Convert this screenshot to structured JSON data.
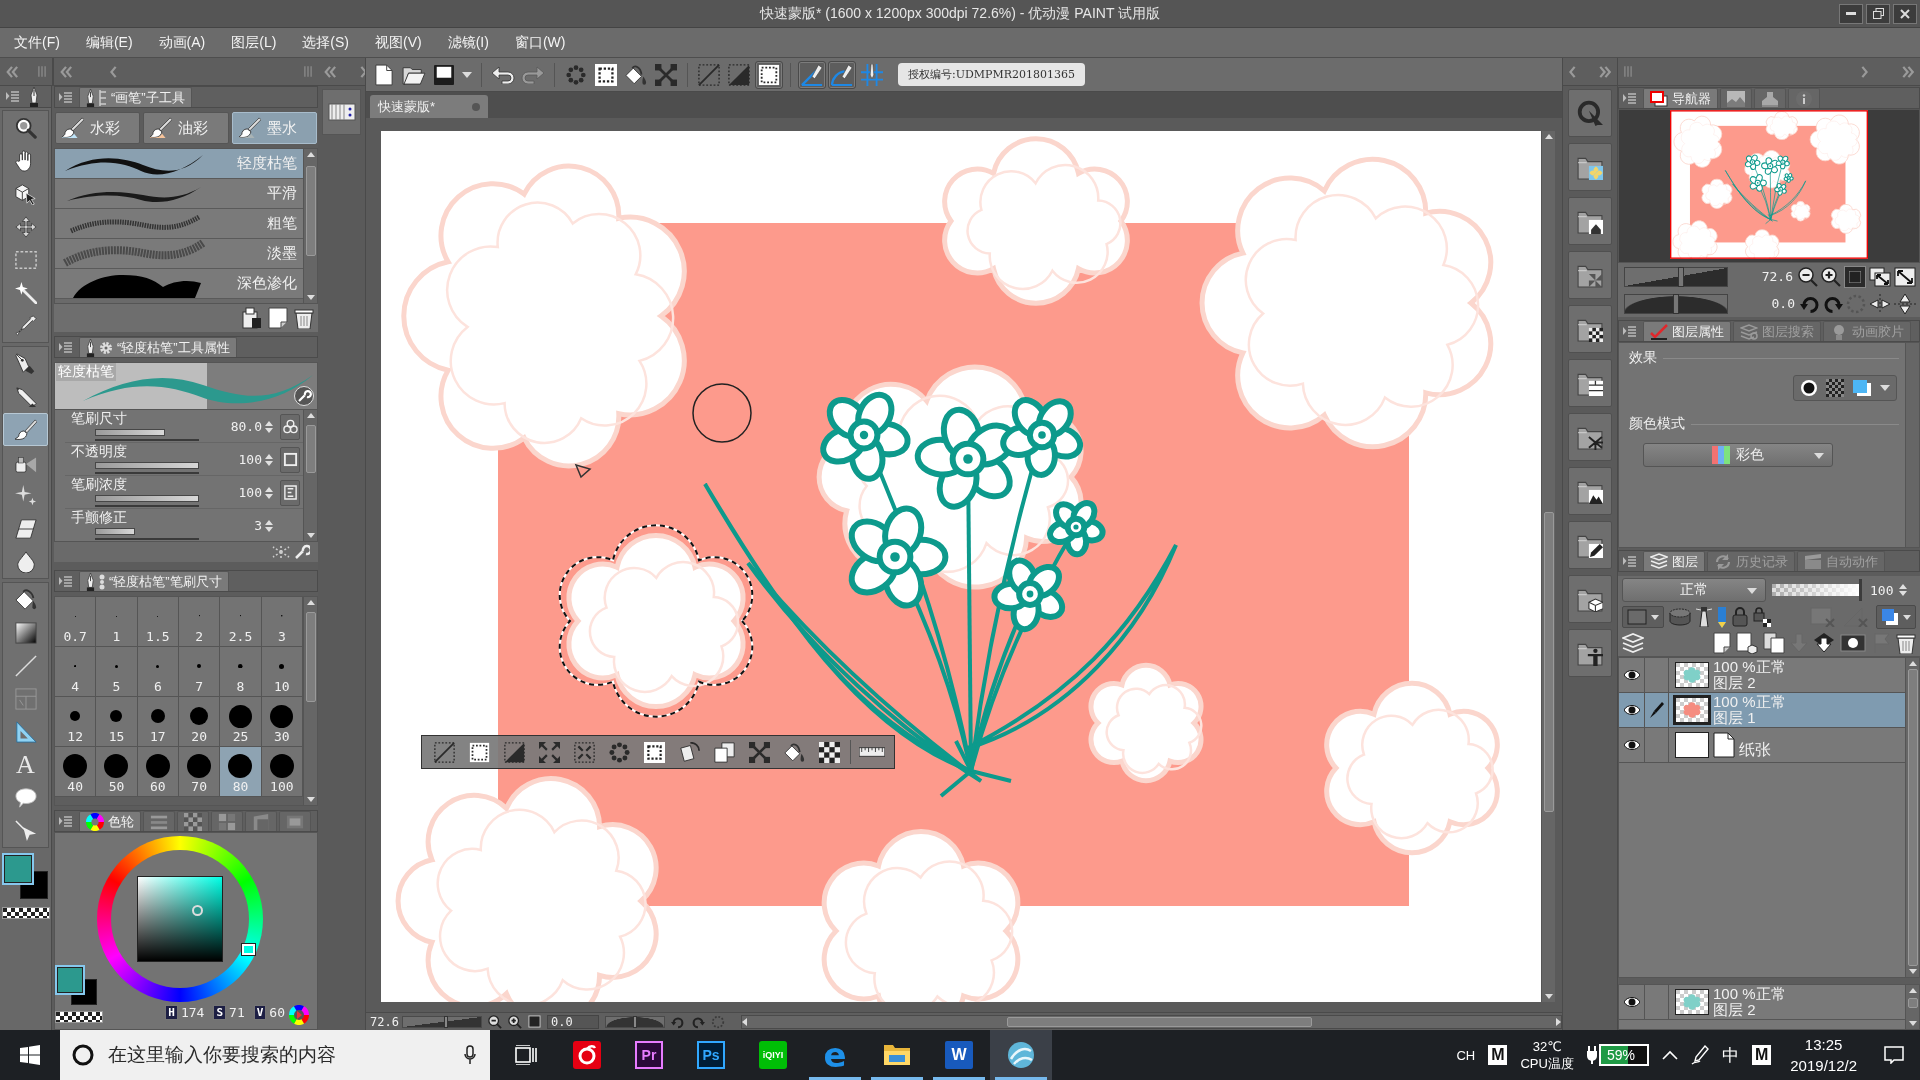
{
  "window": {
    "title": "快速蒙版* (1600 x 1200px 300dpi 72.6%) - 优动漫 PAINT 试用版"
  },
  "menu": [
    {
      "label": "文件(F)"
    },
    {
      "label": "编辑(E)"
    },
    {
      "label": "动画(A)"
    },
    {
      "label": "图层(L)"
    },
    {
      "label": "选择(S)"
    },
    {
      "label": "视图(V)"
    },
    {
      "label": "滤镜(I)"
    },
    {
      "label": "窗口(W)"
    }
  ],
  "toolbox": {
    "groups": [
      {
        "tools": [
          {
            "selected": false
          },
          {
            "selected": false
          },
          {
            "selected": false
          },
          {
            "selected": false
          },
          {
            "selected": false
          },
          {
            "selected": false
          },
          {
            "selected": false
          }
        ]
      },
      {
        "tools": [
          {
            "selected": false
          },
          {
            "selected": false
          },
          {
            "selected": true
          },
          {
            "selected": false
          },
          {
            "selected": false
          },
          {
            "selected": false
          },
          {
            "selected": false
          }
        ]
      },
      {
        "tools": [
          {
            "selected": false
          },
          {
            "selected": false
          },
          {
            "selected": false
          },
          {
            "selected": false
          },
          {
            "selected": false
          },
          {
            "selected": false,
            "glyph": "A"
          },
          {
            "selected": false
          },
          {
            "selected": false
          }
        ]
      }
    ],
    "colors": [
      {
        "color": "#2c998e",
        "selected": true
      },
      {
        "color": "#000000",
        "selected": false
      }
    ]
  },
  "subtool_panel": {
    "title": "“画笔”子工具",
    "groups": [
      {
        "label": "水彩",
        "selected": false
      },
      {
        "label": "油彩",
        "selected": false
      },
      {
        "label": "墨水",
        "selected": true
      }
    ],
    "brushes": [
      {
        "label": "轻度枯笔",
        "selected": true
      },
      {
        "label": "平滑",
        "selected": false
      },
      {
        "label": "粗笔",
        "selected": false
      },
      {
        "label": "淡墨",
        "selected": false
      },
      {
        "label": "深色渗化",
        "selected": false
      }
    ]
  },
  "tool_property": {
    "title": "“轻度枯笔”工具属性",
    "preview_label": "轻度枯笔",
    "properties": [
      {
        "label": "笔刷尺寸",
        "value": "80.0",
        "level": 0.67
      },
      {
        "label": "不透明度",
        "value": "100",
        "level": 1
      },
      {
        "label": "笔刷浓度",
        "value": "100",
        "level": 1
      },
      {
        "label": "手颤修正",
        "value": "3",
        "level": 0.38
      }
    ]
  },
  "brush_size_panel": {
    "title": "“轻度枯笔”笔刷尺寸",
    "sizes": [
      {
        "label": "0.7",
        "selected": false
      },
      {
        "label": "1",
        "selected": false
      },
      {
        "label": "1.5",
        "selected": false
      },
      {
        "label": "2",
        "selected": false
      },
      {
        "label": "2.5",
        "selected": false
      },
      {
        "label": "3",
        "selected": false
      },
      {
        "label": "4",
        "selected": false
      },
      {
        "label": "5",
        "selected": false
      },
      {
        "label": "6",
        "selected": false
      },
      {
        "label": "7",
        "selected": false
      },
      {
        "label": "8",
        "selected": false
      },
      {
        "label": "10",
        "selected": false
      },
      {
        "label": "12",
        "selected": false
      },
      {
        "label": "15",
        "selected": false
      },
      {
        "label": "17",
        "selected": false
      },
      {
        "label": "20",
        "selected": false
      },
      {
        "label": "25",
        "selected": false
      },
      {
        "label": "30",
        "selected": false
      },
      {
        "label": "40",
        "selected": false
      },
      {
        "label": "50",
        "selected": false
      },
      {
        "label": "60",
        "selected": false
      },
      {
        "label": "70",
        "selected": false
      },
      {
        "label": "80",
        "selected": true
      },
      {
        "label": "100",
        "selected": false
      }
    ]
  },
  "color_panel": {
    "tabs": [
      {
        "label": "色轮",
        "selected": true
      },
      {
        "selected": false
      },
      {
        "selected": false
      },
      {
        "selected": false
      },
      {
        "selected": false
      },
      {
        "selected": false
      }
    ],
    "colors": [
      {
        "color": "#2c998e",
        "selected": true
      },
      {
        "color": "#000000",
        "selected": false
      }
    ],
    "hsv": [
      {
        "label": "H",
        "value": "174"
      },
      {
        "label": "S",
        "value": "71"
      },
      {
        "label": "V",
        "value": "60"
      }
    ]
  },
  "command_bar": {
    "buttons": [
      {
        "on": false,
        "disabled": false
      },
      {
        "on": false,
        "disabled": false
      },
      {
        "on": false,
        "disabled": false
      },
      {
        "on": false,
        "disabled": false
      },
      {
        "on": false,
        "disabled": false
      },
      {
        "on": false,
        "disabled": true
      },
      {
        "on": false,
        "disabled": false
      },
      {
        "on": false,
        "disabled": false
      },
      {
        "on": false,
        "disabled": false
      },
      {
        "on": false,
        "disabled": false
      },
      {
        "on": false,
        "disabled": false
      },
      {
        "on": false,
        "disabled": false
      },
      {
        "on": true,
        "disabled": false
      },
      {
        "on": true,
        "disabled": false
      },
      {
        "on": true,
        "disabled": false
      },
      {
        "on": false,
        "disabled": false
      }
    ],
    "license": "授权编号:UDMPMR201801365"
  },
  "document": {
    "tab": "快速蒙版*"
  },
  "canvas_status": {
    "zoom": "72.6",
    "zoom_slider": {
      "level": 0.55
    },
    "rotation": "0.0",
    "rotation_slider": {
      "level": 0.5
    }
  },
  "navigator": {
    "tabs": [
      {
        "label": "导航器",
        "selected": true
      },
      {
        "selected": false
      },
      {
        "selected": false
      },
      {
        "selected": false
      }
    ],
    "zoom": "72.6",
    "rotation": "0.0",
    "zoom_slider": {
      "level": 0.55
    },
    "rotation_slider": {
      "level": 0.5
    }
  },
  "layer_property": {
    "tabs": [
      {
        "label": "图层属性",
        "selected": true
      },
      {
        "label": "图层搜索",
        "selected": false
      },
      {
        "label": "动画胶片",
        "selected": false
      }
    ],
    "effect_label": "效果",
    "color_mode_label": "颜色模式",
    "color_mode": "彩色"
  },
  "layers_panel": {
    "tabs": [
      {
        "label": "图层",
        "selected": true
      },
      {
        "label": "历史记录",
        "selected": false
      },
      {
        "label": "自动动作",
        "selected": false
      }
    ],
    "blend_mode": "正常",
    "opacity": {
      "value": "100",
      "level": 1
    },
    "layers": [
      {
        "kind": "raster",
        "info": "100 %正常",
        "name": "图层 2",
        "visible": true,
        "editing": false,
        "selected": false
      },
      {
        "kind": "raster",
        "info": "100 %正常",
        "name": "图层 1",
        "visible": true,
        "editing": true,
        "selected": true
      },
      {
        "kind": "paper",
        "name": "纸张",
        "visible": true,
        "editing": false,
        "selected": false
      }
    ],
    "split_layers": [
      {
        "kind": "raster",
        "info": "100 %正常",
        "name": "图层 2",
        "visible": true,
        "editing": false,
        "selected": false
      }
    ]
  },
  "taskbar": {
    "search_placeholder": "在这里输入你要搜索的内容",
    "apps": [
      {
        "running": false,
        "selected": false
      },
      {
        "label": "Pr",
        "running": false,
        "selected": false
      },
      {
        "label": "Ps",
        "running": false,
        "selected": false
      },
      {
        "label": "iQIYI",
        "running": false,
        "selected": false
      },
      {
        "label": "e",
        "running": true,
        "selected": false
      },
      {
        "running": true,
        "selected": false
      },
      {
        "label": "W",
        "running": true,
        "selected": false
      },
      {
        "running": true,
        "selected": true
      }
    ],
    "tray": {
      "language": "CH",
      "ime_mode": "M",
      "temperature": "32℃",
      "temperature_label": "CPU温度",
      "battery": {
        "value": "59%",
        "level": 0.59
      },
      "input_mode": "中",
      "ime_badge": "M",
      "time": "13:25",
      "date": "2019/12/2"
    }
  }
}
